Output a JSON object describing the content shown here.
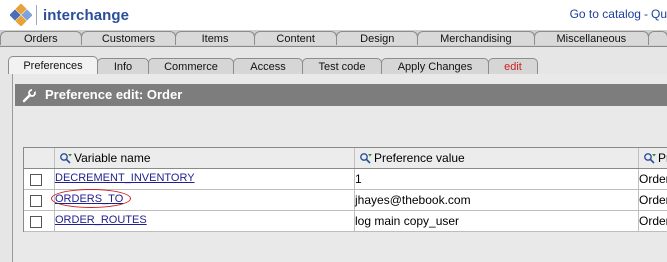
{
  "header": {
    "brand": "interchange",
    "links": [
      "Go to catalog",
      "Qu"
    ]
  },
  "main_tabs": [
    {
      "label": "Orders"
    },
    {
      "label": "Customers"
    },
    {
      "label": "Items"
    },
    {
      "label": "Content"
    },
    {
      "label": "Design"
    },
    {
      "label": "Merchandising"
    },
    {
      "label": "Miscellaneous"
    }
  ],
  "sub_tabs": [
    {
      "label": "Preferences",
      "active": true
    },
    {
      "label": "Info"
    },
    {
      "label": "Commerce"
    },
    {
      "label": "Access"
    },
    {
      "label": "Test code"
    },
    {
      "label": "Apply Changes"
    },
    {
      "label": "edit",
      "color": "#cc2222"
    }
  ],
  "panel": {
    "title": "Preference edit: Order"
  },
  "table": {
    "columns": [
      "Variable name",
      "Preference value",
      "Pr"
    ],
    "rows": [
      {
        "name": "DECREMENT_INVENTORY",
        "value": "1",
        "third": "Order"
      },
      {
        "name": "ORDERS_TO",
        "value": "jhayes@thebook.com",
        "third": "Order",
        "highlighted": true
      },
      {
        "name": "ORDER_ROUTES",
        "value": "log main copy_user",
        "third": "Order"
      }
    ]
  },
  "colors": {
    "brand": "#2a4f9a",
    "titlebar": "#7d7d7d",
    "highlight_ring": "#cc2222"
  }
}
